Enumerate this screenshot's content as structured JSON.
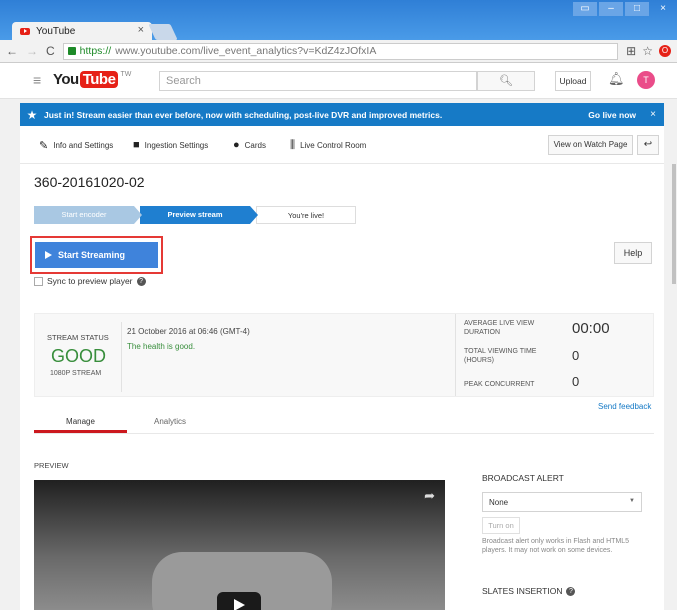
{
  "browser": {
    "tab_title": "YouTube",
    "tab_close": "×",
    "url_https": "https://",
    "url_rest": "www.youtube.com/live_event_analytics?v=KdZ4zJOfxIA",
    "window_controls": [
      "▭",
      "–",
      "□",
      "×"
    ]
  },
  "header": {
    "logo_you": "You",
    "logo_tube": "Tube",
    "logo_region": "TW",
    "search_placeholder": "Search",
    "upload_label": "Upload",
    "avatar_letter": "T"
  },
  "banner": {
    "text": "Just in! Stream easier than ever before, now with scheduling, post-live DVR and improved metrics.",
    "go_label": "Go live now",
    "close": "×"
  },
  "toolbar": {
    "info": "Info and Settings",
    "ingestion": "Ingestion Settings",
    "cards": "Cards",
    "live_control": "Live Control Room",
    "watch_page": "View on Watch Page"
  },
  "event": {
    "title": "360-20161020-02"
  },
  "steps": [
    "Start encoder",
    "Preview stream",
    "You're live!"
  ],
  "start_streaming": "Start Streaming",
  "sync_label": "Sync to preview player",
  "help_label": "Help",
  "status": {
    "label": "STREAM STATUS",
    "value": "GOOD",
    "quality": "1080P STREAM",
    "date": "21 October 2016 at 06:46 (GMT-4)",
    "health": "The health is good."
  },
  "metrics": [
    {
      "label": "AVERAGE LIVE VIEW DURATION",
      "value": "00:00"
    },
    {
      "label": "TOTAL VIEWING TIME (HOURS)",
      "value": "0"
    },
    {
      "label": "PEAK CONCURRENT",
      "value": "0"
    }
  ],
  "feedback": "Send feedback",
  "tabs": {
    "manage": "Manage",
    "analytics": "Analytics"
  },
  "preview_label": "PREVIEW",
  "broadcast_alert": {
    "title": "BROADCAST ALERT",
    "selected": "None",
    "turn_on": "Turn on",
    "note": "Broadcast alert only works in Flash and HTML5 players. It may not work on some devices."
  },
  "slates_title": "SLATES INSERTION",
  "colors": {
    "banner": "#167ac6",
    "good": "#388e3c",
    "start_button": "#3f83db",
    "highlight": "#e53935",
    "brand": "#e62117"
  }
}
